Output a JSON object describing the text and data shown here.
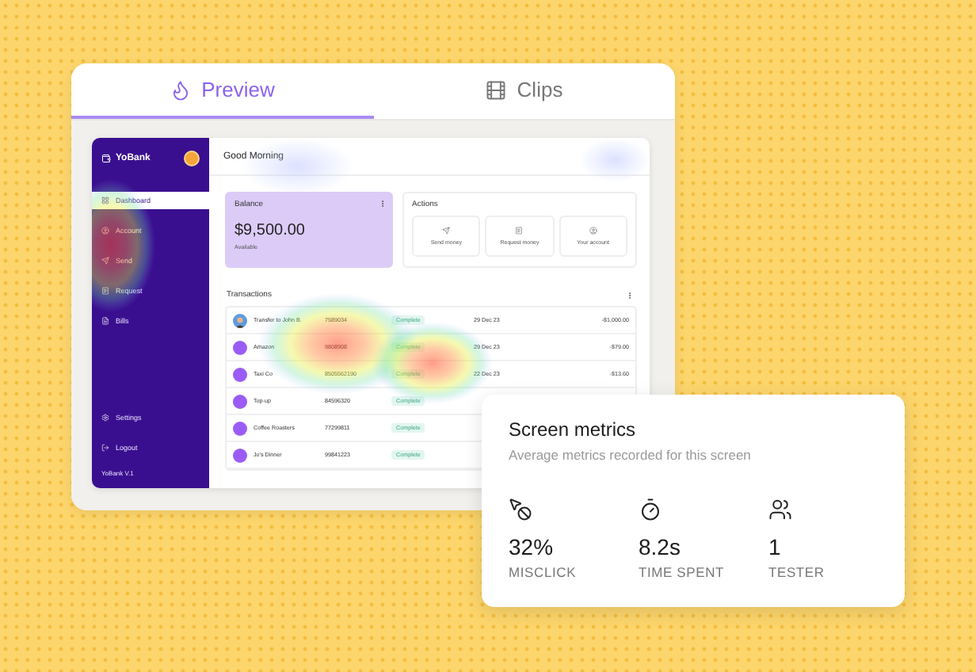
{
  "tabs": [
    {
      "label": "Preview",
      "kind": "preview",
      "selected": true
    },
    {
      "label": "Clips",
      "kind": "clips",
      "selected": false
    }
  ],
  "app": {
    "brand": "YoBank",
    "greeting": "Good Morning",
    "sidebar": {
      "items": [
        {
          "label": "Dashboard",
          "kind": "dashboard",
          "selected": true
        },
        {
          "label": "Account",
          "kind": "account",
          "selected": false
        },
        {
          "label": "Send",
          "kind": "send",
          "selected": false
        },
        {
          "label": "Request",
          "kind": "request",
          "selected": false
        },
        {
          "label": "Bills",
          "kind": "bills",
          "selected": false
        }
      ],
      "footer": [
        {
          "label": "Settings",
          "kind": "settings"
        },
        {
          "label": "Logout",
          "kind": "logout"
        }
      ],
      "version": "YoBank V.1"
    },
    "balance": {
      "title": "Balance",
      "amount": "$9,500.00",
      "caption": "Available"
    },
    "actions": {
      "title": "Actions",
      "items": [
        {
          "label": "Send money",
          "kind": "send"
        },
        {
          "label": "Request money",
          "kind": "request"
        },
        {
          "label": "Your account",
          "kind": "account"
        }
      ]
    },
    "transactions": {
      "title": "Transactions",
      "rows": [
        {
          "name": "Transfer to John B.",
          "kind": "person",
          "account": "7589034",
          "status": "Complete",
          "date": "29 Dec 23",
          "amount": "-$1,000.00"
        },
        {
          "name": "Amazon",
          "kind": "plain",
          "account": "9808908",
          "status": "Complete",
          "date": "29 Dec 23",
          "amount": "-$79.00"
        },
        {
          "name": "Taxi Co",
          "kind": "plain",
          "account": "8505562190",
          "status": "Complete",
          "date": "22 Dec 23",
          "amount": "-$13.60"
        },
        {
          "name": "Top-up",
          "kind": "plain",
          "account": "84596320",
          "status": "Complete"
        },
        {
          "name": "Coffee Roasters",
          "kind": "plain",
          "account": "77299811",
          "status": "Complete"
        },
        {
          "name": "Jo's Dinner",
          "kind": "plain",
          "account": "99841223",
          "status": "Complete"
        }
      ]
    }
  },
  "metrics": {
    "title": "Screen metrics",
    "subtitle": "Average metrics recorded for this screen",
    "items": [
      {
        "kind": "misclick",
        "value": "32%",
        "label": "MISCLICK"
      },
      {
        "kind": "time",
        "value": "8.2s",
        "label": "TIME SPENT"
      },
      {
        "kind": "testers",
        "value": "1",
        "label": "TESTER"
      }
    ]
  }
}
